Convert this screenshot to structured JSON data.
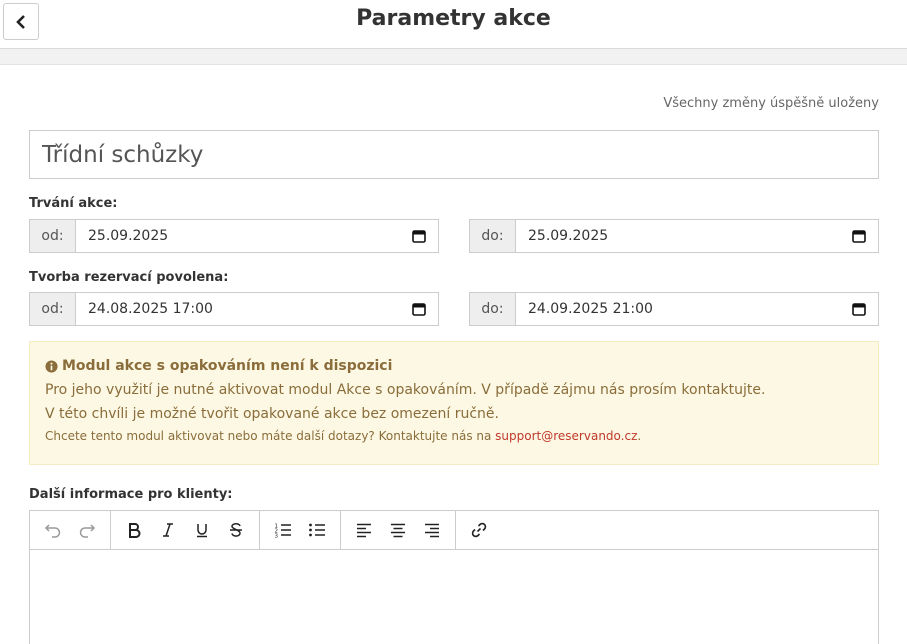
{
  "header": {
    "title": "Parametry akce"
  },
  "status": {
    "saved": "Všechny změny úspěšně uloženy"
  },
  "form": {
    "event_name": "Třídní schůzky",
    "duration": {
      "label": "Trvání akce:",
      "from_label": "od:",
      "from_value": "25.09.2025",
      "to_label": "do:",
      "to_value": "25.09.2025"
    },
    "reservations": {
      "label": "Tvorba rezervací povolena:",
      "from_label": "od:",
      "from_value": "24.08.2025 17:00",
      "to_label": "do:",
      "to_value": "24.09.2025 21:00"
    },
    "info_label": "Další informace pro klienty:"
  },
  "alert": {
    "title": "Modul akce s opakováním není k dispozici",
    "line1": "Pro jeho využití je nutné aktivovat modul Akce s opakováním. V případě zájmu nás prosím kontaktujte.",
    "line2": "V této chvíli je možné tvořit opakované akce bez omezení ručně.",
    "small_text": "Chcete tento modul aktivovat nebo máte další dotazy? Kontaktujte nás na ",
    "email": "support@reservando.cz",
    "small_tail": "."
  },
  "colors": {
    "alert_bg": "#fcf8e3",
    "alert_text": "#8a6d3b",
    "link": "#c0392b"
  }
}
